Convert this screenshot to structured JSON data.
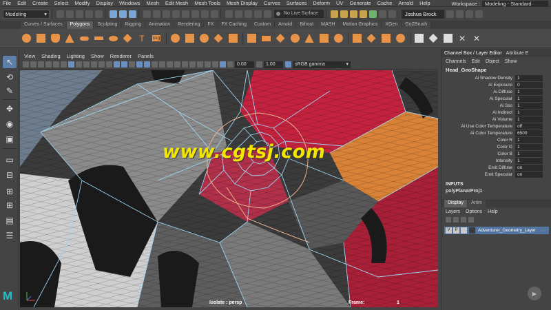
{
  "menu_bar": {
    "items": [
      "File",
      "Edit",
      "Create",
      "Select",
      "Modify",
      "Display",
      "Windows",
      "Mesh",
      "Edit Mesh",
      "Mesh Tools",
      "Mesh Display",
      "Curves",
      "Surfaces",
      "Deform",
      "UV",
      "Generate",
      "Cache",
      "Arnold",
      "Help"
    ],
    "workspace_label": "Workspace :",
    "workspace_value": "Modeling - Standard"
  },
  "status_line": {
    "mode": "Modeling",
    "live_surface": "No Live Surface",
    "user": "Joshua Brock"
  },
  "shelf": {
    "tabs": [
      "Curves / Surfaces",
      "Polygons",
      "Sculpting",
      "Rigging",
      "Animation",
      "Rendering",
      "FX",
      "FX Caching",
      "Custom",
      "Arnold",
      "Bifrost",
      "MASH",
      "Motion Graphics",
      "XGen",
      "GoZBrush"
    ],
    "active_tab": "Polygons",
    "text_tool_glyph": "T",
    "svg_tool_glyph": "svg"
  },
  "viewport": {
    "menu": [
      "View",
      "Shading",
      "Lighting",
      "Show",
      "Renderer",
      "Panels"
    ],
    "exposure": "0.00",
    "gamma": "1.00",
    "color_space": "sRGB gamma",
    "hud_isolate": "Isolate : persp",
    "hud_frame_label": "Frame:",
    "hud_frame_value": "1",
    "watermark": "www.cgtsj.com"
  },
  "channel_box": {
    "tabs": [
      "Channel Box / Layer Editor",
      "Attribute E"
    ],
    "menu": [
      "Channels",
      "Edit",
      "Object",
      "Show"
    ],
    "object_name": "Head_GeoShape",
    "attributes": [
      {
        "name": "Ai Shadow Density",
        "value": "1"
      },
      {
        "name": "Ai Exposure",
        "value": "0"
      },
      {
        "name": "Ai Diffuse",
        "value": "1"
      },
      {
        "name": "Ai Specular",
        "value": "1"
      },
      {
        "name": "Ai Sss",
        "value": "1"
      },
      {
        "name": "Ai Indirect",
        "value": "1"
      },
      {
        "name": "Ai Volume",
        "value": "1"
      },
      {
        "name": "Ai Use Color Temperature",
        "value": "off"
      },
      {
        "name": "Ai Color Temperature",
        "value": "6500"
      },
      {
        "name": "Color R",
        "value": "1"
      },
      {
        "name": "Color G",
        "value": "1"
      },
      {
        "name": "Color B",
        "value": "1"
      },
      {
        "name": "Intensity",
        "value": "1"
      },
      {
        "name": "Emit Diffuse",
        "value": "on"
      },
      {
        "name": "Emit Specular",
        "value": "on"
      }
    ],
    "inputs_header": "INPUTS",
    "input_node": "polyPlanarProj1"
  },
  "layer_editor": {
    "tabs": [
      "Display",
      "Anim"
    ],
    "active_tab": "Display",
    "menu": [
      "Layers",
      "Options",
      "Help"
    ],
    "layer": {
      "visible_flag": "V",
      "playback_flag": "P",
      "name": "Adventurer_Geometry_Layer"
    }
  },
  "colors": {
    "accent": "#5d7fa8",
    "layer_row": "#5375a0",
    "watermark": "#f2e600",
    "wire": "#9fd3f0",
    "soft_select": "#e8b090"
  }
}
